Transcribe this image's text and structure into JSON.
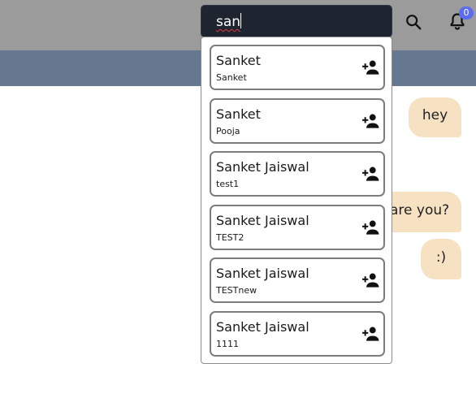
{
  "search": {
    "value": "san"
  },
  "header": {
    "icons": [
      "search-icon",
      "bell-icon"
    ],
    "notification_count": "0",
    "colors": {
      "topbar": "#9b9b9b",
      "subbar": "#667890",
      "search_bg": "#1e2530",
      "badge": "#5b6cf0"
    }
  },
  "chat": {
    "bubble_color": "#f6e1c3",
    "messages": [
      {
        "text": "hey"
      },
      {
        "text": "are you?"
      },
      {
        "text": ":)"
      }
    ]
  },
  "results": [
    {
      "name": "Sanket",
      "username": "Sanket",
      "action_icon": "add-user-icon"
    },
    {
      "name": "Sanket",
      "username": "Pooja",
      "action_icon": "add-user-icon"
    },
    {
      "name": "Sanket Jaiswal",
      "username": "test1",
      "action_icon": "add-user-icon"
    },
    {
      "name": "Sanket Jaiswal",
      "username": "TEST2",
      "action_icon": "add-user-icon"
    },
    {
      "name": "Sanket Jaiswal",
      "username": "TESTnew",
      "action_icon": "add-user-icon"
    },
    {
      "name": "Sanket Jaiswal",
      "username": "1111",
      "action_icon": "add-user-icon"
    }
  ]
}
